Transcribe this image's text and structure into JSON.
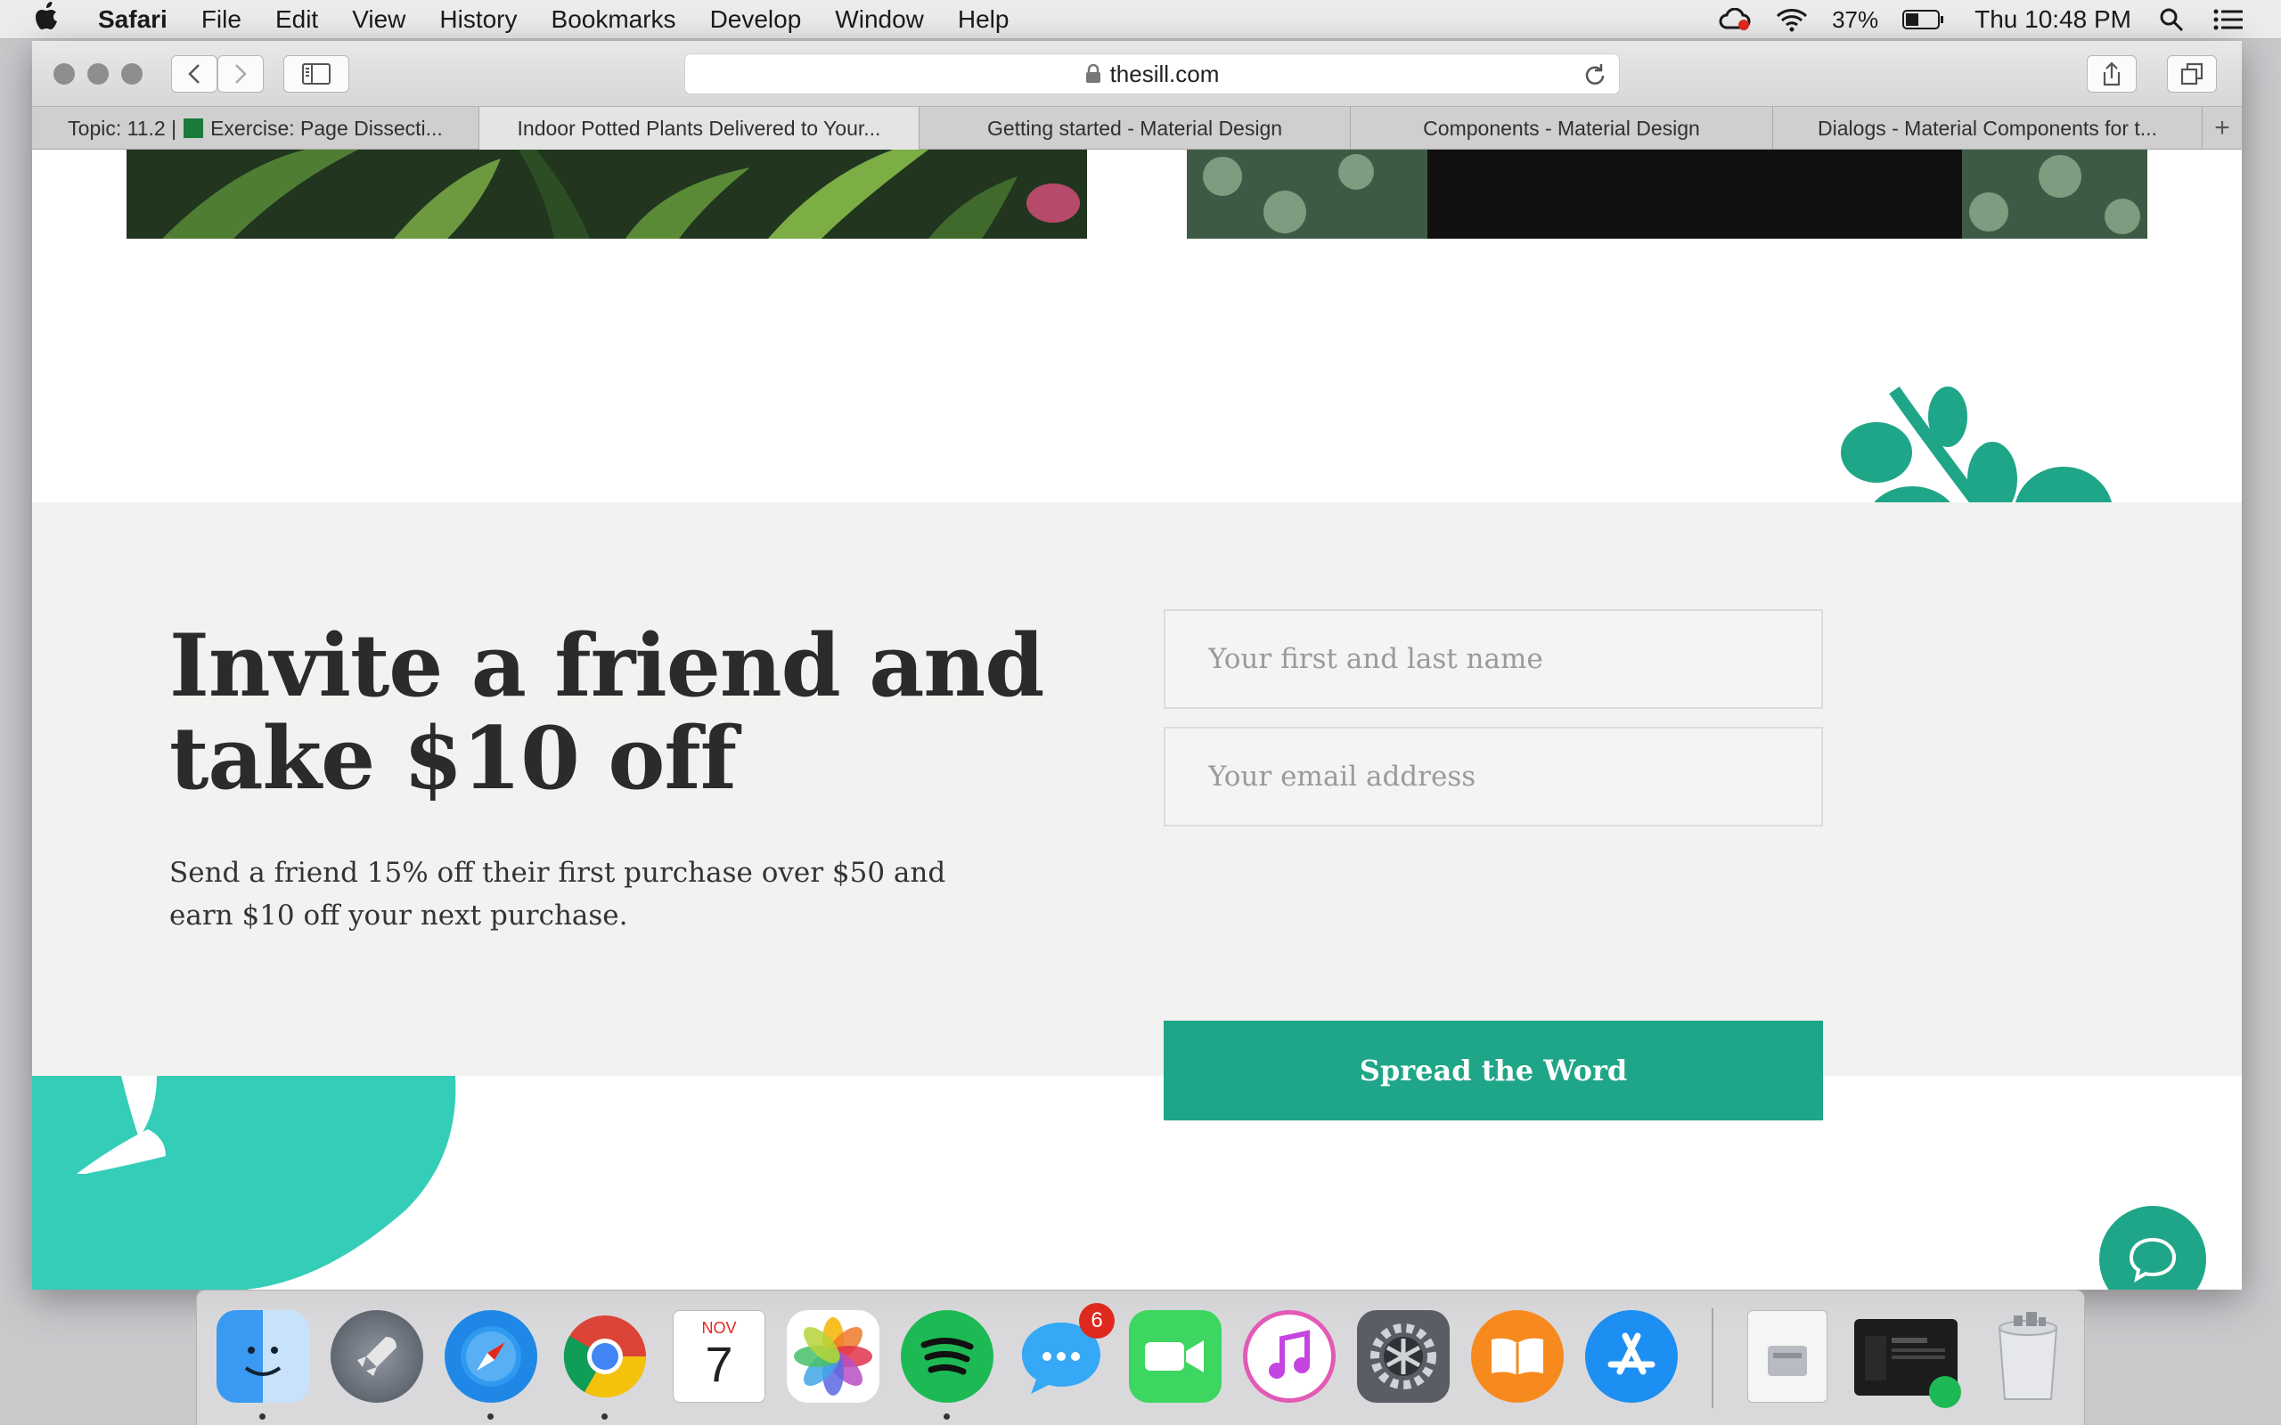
{
  "menubar": {
    "app_name": "Safari",
    "menus": [
      "File",
      "Edit",
      "View",
      "History",
      "Bookmarks",
      "Develop",
      "Window",
      "Help"
    ],
    "battery": "37%",
    "clock": "Thu 10:48 PM"
  },
  "browser": {
    "url": "thesill.com",
    "tabs": [
      {
        "prefix": "Topic: 11.2 |",
        "label": "Exercise: Page Dissecti..."
      },
      {
        "label": "Indoor Potted Plants Delivered to Your..."
      },
      {
        "label": "Getting started - Material Design"
      },
      {
        "label": "Components - Material Design"
      },
      {
        "label": "Dialogs - Material Components for t..."
      }
    ],
    "new_tab_label": "+"
  },
  "promo": {
    "headline": "Invite a friend and take $10 off",
    "description": "Send a friend 15% off their first purchase over $50 and earn $10 off your next purchase.",
    "name_placeholder": "Your first and last name",
    "email_placeholder": "Your email address",
    "cta_label": "Spread the Word"
  },
  "dock": {
    "calendar_month": "NOV",
    "calendar_day": "7",
    "messages_badge": "6",
    "apps": [
      "finder-icon",
      "launchpad-icon",
      "safari-icon",
      "chrome-icon",
      "calendar-icon",
      "photos-icon",
      "spotify-icon",
      "messages-icon",
      "facetime-icon",
      "itunes-icon",
      "system-preferences-icon",
      "ibooks-icon",
      "app-store-icon"
    ]
  },
  "colors": {
    "brand_green": "#1fa587",
    "promo_background": "#f2f2f0",
    "leaf_teal": "#3bc9b5"
  }
}
